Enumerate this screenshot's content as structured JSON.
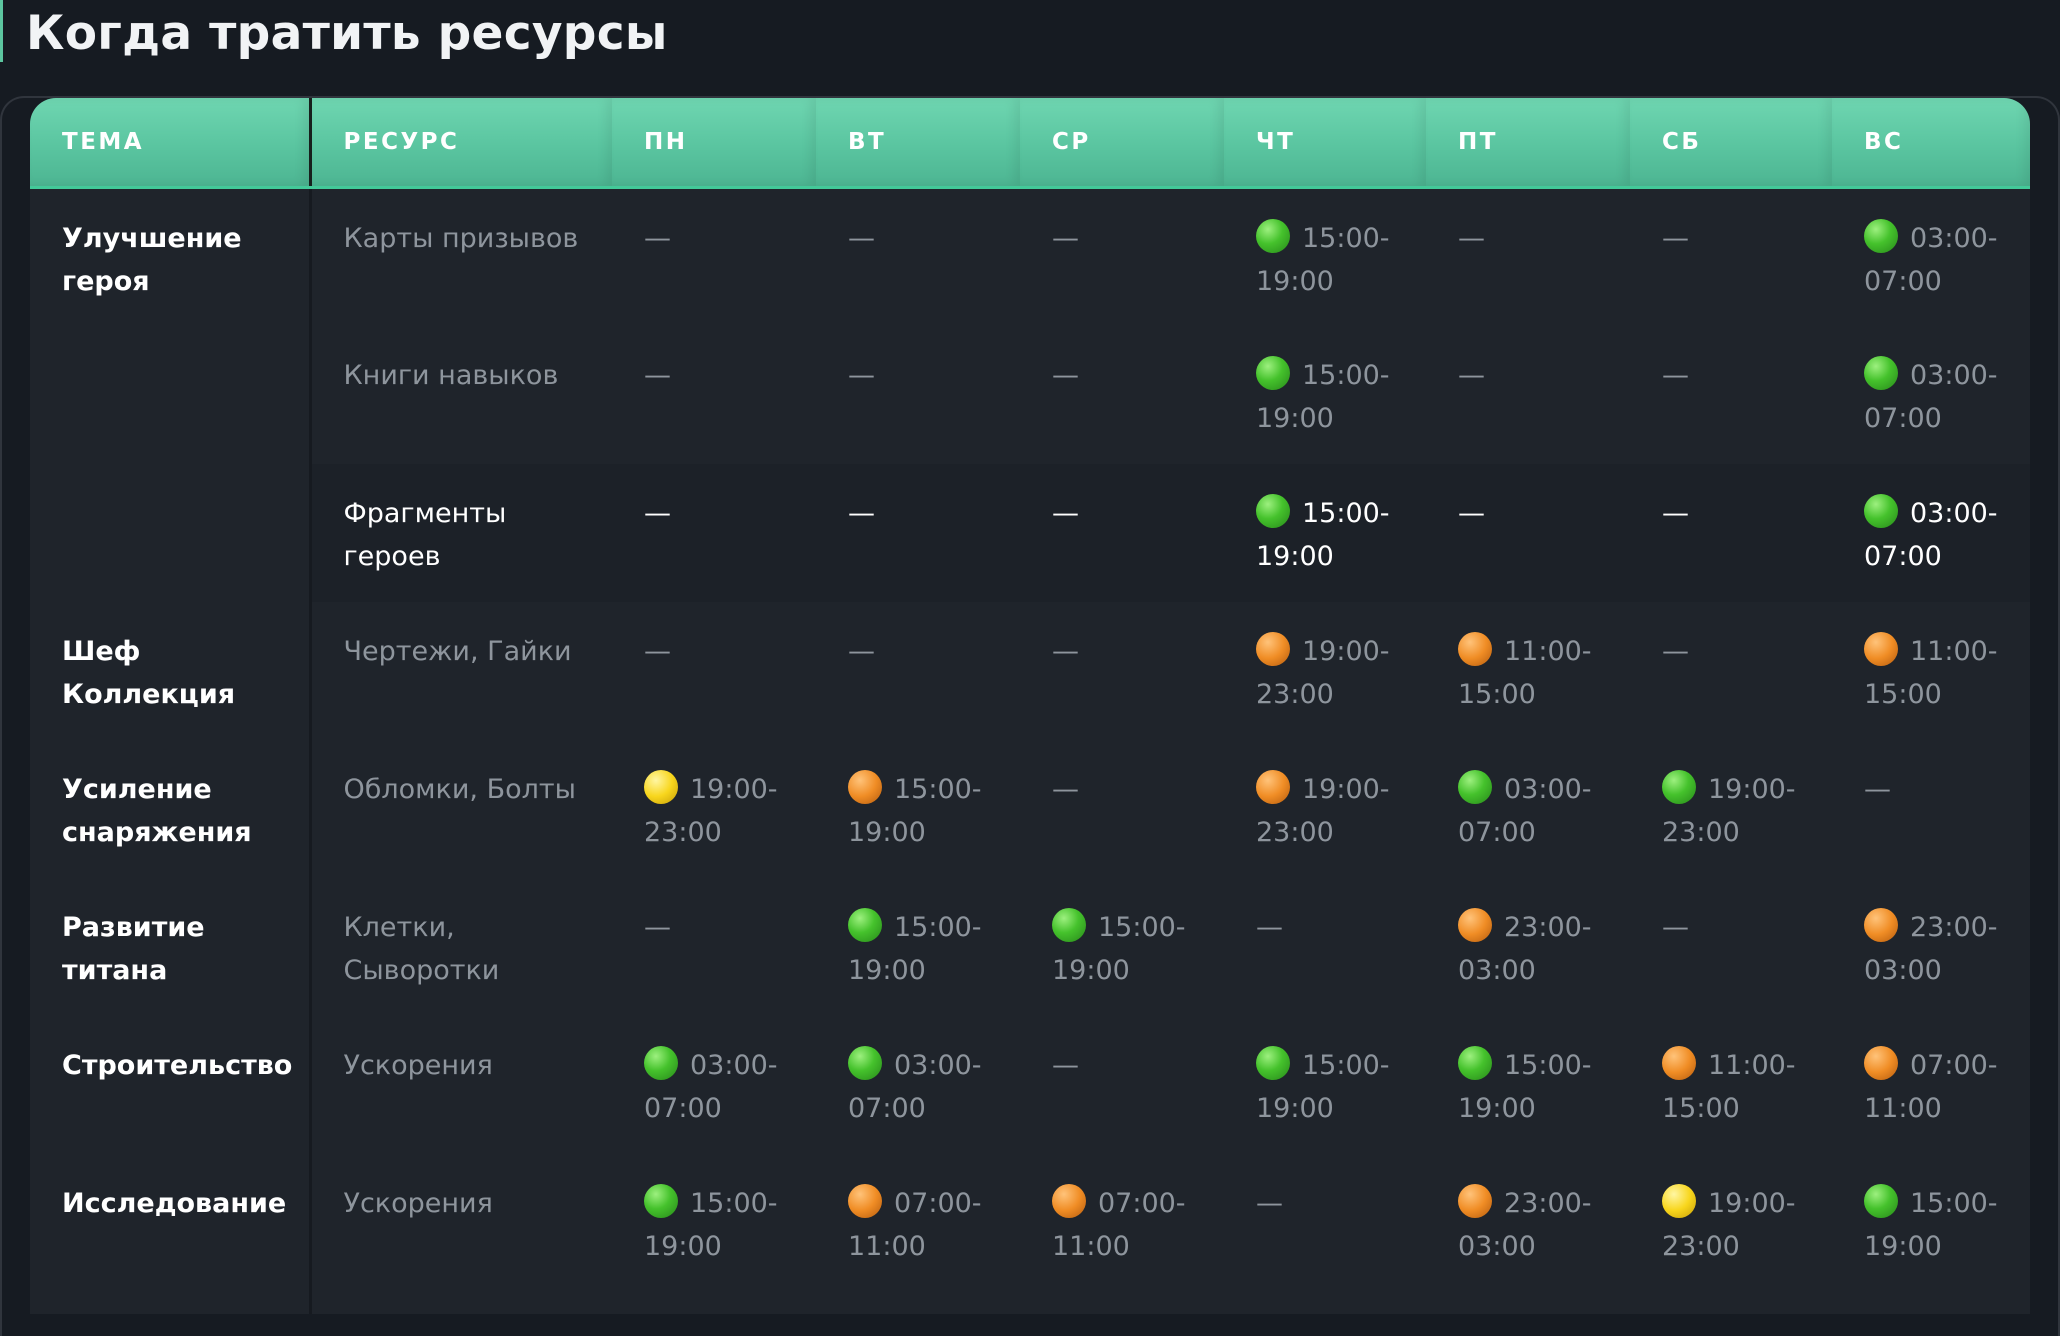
{
  "page": {
    "title": "Когда тратить ресурсы"
  },
  "colors": {
    "accent": "#5cc6a0",
    "header_bg": "#5ac5a0",
    "body_bg": "#1f242b",
    "page_bg": "#161b22",
    "status_green": "#45c22c",
    "status_orange": "#f08d25",
    "status_yellow": "#f8d61d"
  },
  "table": {
    "headers": {
      "topic": "ТЕМА",
      "resource": "РЕСУРС",
      "mon": "ПН",
      "tue": "ВТ",
      "wed": "СР",
      "thu": "ЧТ",
      "fri": "ПТ",
      "sat": "СБ",
      "sun": "ВС"
    },
    "topics": {
      "hero_upgrade": "Улучшение героя",
      "chef_collection": "Шеф Коллекция",
      "gear_boost": "Усиление снаряжения",
      "titan_dev": "Развитие титана",
      "construction": "Строительство",
      "research": "Исследование"
    },
    "rows": [
      {
        "resource": "Карты призывов",
        "mon": "—",
        "tue": "—",
        "wed": "—",
        "thu": "15:00-19:00",
        "thu_dot": "green",
        "fri": "—",
        "sat": "—",
        "sun": "03:00-07:00",
        "sun_dot": "green"
      },
      {
        "resource": "Книги навыков",
        "mon": "—",
        "tue": "—",
        "wed": "—",
        "thu": "15:00-19:00",
        "thu_dot": "green",
        "fri": "—",
        "sat": "—",
        "sun": "03:00-07:00",
        "sun_dot": "green"
      },
      {
        "resource": "Фрагменты героев",
        "mon": "—",
        "tue": "—",
        "wed": "—",
        "thu": "15:00-19:00",
        "thu_dot": "green",
        "fri": "—",
        "sat": "—",
        "sun": "03:00-07:00",
        "sun_dot": "green"
      },
      {
        "resource": "Чертежи, Гайки",
        "mon": "—",
        "tue": "—",
        "wed": "—",
        "thu": "19:00-23:00",
        "thu_dot": "orange",
        "fri": "11:00-15:00",
        "fri_dot": "orange",
        "sat": "—",
        "sun": "11:00-15:00",
        "sun_dot": "orange"
      },
      {
        "resource": "Обломки, Болты",
        "mon": "19:00-23:00",
        "mon_dot": "yellow",
        "tue": "15:00-19:00",
        "tue_dot": "orange",
        "wed": "—",
        "thu": "19:00-23:00",
        "thu_dot": "orange",
        "fri": "03:00-07:00",
        "fri_dot": "green",
        "sat": "19:00-23:00",
        "sat_dot": "green",
        "sun": "—"
      },
      {
        "resource": "Клетки, Сыворотки",
        "mon": "—",
        "tue": "15:00-19:00",
        "tue_dot": "green",
        "wed": "15:00-19:00",
        "wed_dot": "green",
        "thu": "—",
        "fri": "23:00-03:00",
        "fri_dot": "orange",
        "sat": "—",
        "sun": "23:00-03:00",
        "sun_dot": "orange"
      },
      {
        "resource": "Ускорения",
        "mon": "03:00-07:00",
        "mon_dot": "green",
        "tue": "03:00-07:00",
        "tue_dot": "green",
        "wed": "—",
        "thu": "15:00-19:00",
        "thu_dot": "green",
        "fri": "15:00-19:00",
        "fri_dot": "green",
        "sat": "11:00-15:00",
        "sat_dot": "orange",
        "sun": "07:00-11:00",
        "sun_dot": "orange"
      },
      {
        "resource": "Ускорения",
        "mon": "15:00-19:00",
        "mon_dot": "green",
        "tue": "07:00-11:00",
        "tue_dot": "orange",
        "wed": "07:00-11:00",
        "wed_dot": "orange",
        "thu": "—",
        "fri": "23:00-03:00",
        "fri_dot": "orange",
        "sat": "19:00-23:00",
        "sat_dot": "yellow",
        "sun": "15:00-19:00",
        "sun_dot": "green"
      }
    ]
  }
}
